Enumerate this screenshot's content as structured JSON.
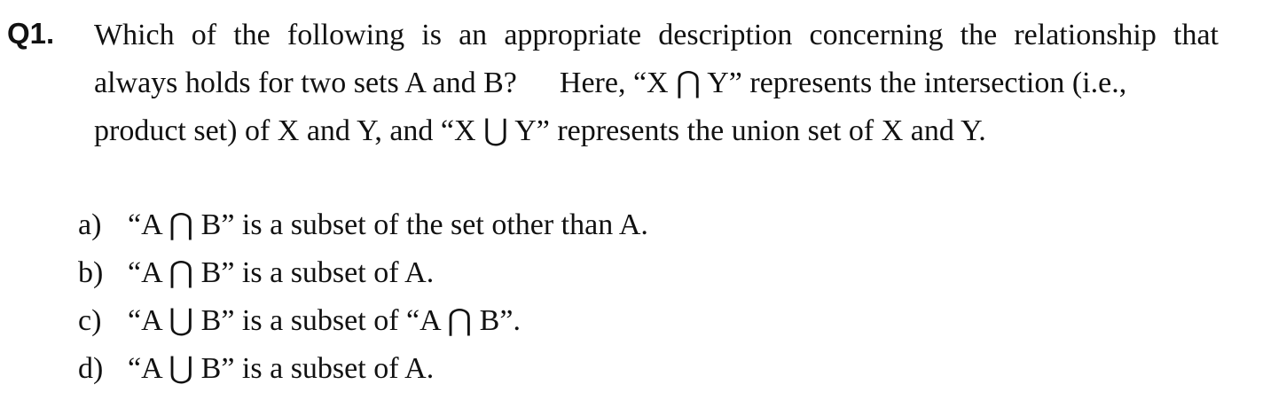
{
  "question": {
    "number": "Q1.",
    "stem_lines": [
      "Which of the following is an appropriate description concerning the relationship that",
      "always holds for two sets A and B?",
      "Here, “X ⋂ Y” represents the intersection (i.e.,",
      "product set) of X and Y, and “X ⋃ Y” represents the union set of X and Y."
    ]
  },
  "options": [
    {
      "label": "a)",
      "text": "“A ⋂ B” is a subset of the set other than A."
    },
    {
      "label": "b)",
      "text": "“A ⋂ B” is a subset of A."
    },
    {
      "label": "c)",
      "text": "“A ⋃ B” is a subset of “A ⋂ B”."
    },
    {
      "label": "d)",
      "text": "“A ⋃ B” is a subset of A."
    }
  ]
}
